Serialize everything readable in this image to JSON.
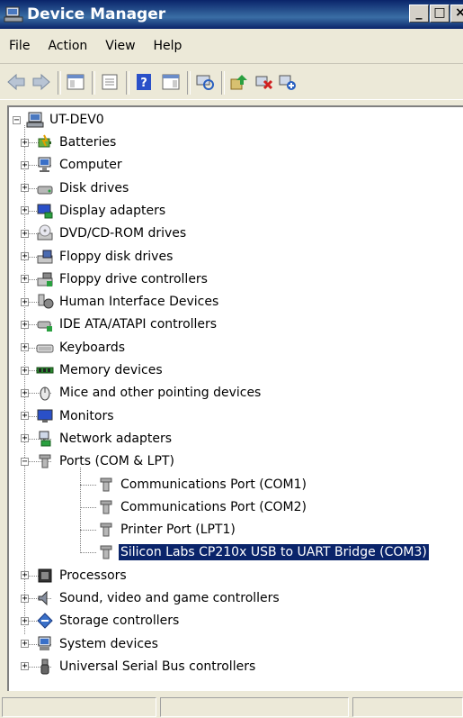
{
  "window": {
    "title": "Device Manager"
  },
  "menu": [
    "File",
    "Action",
    "View",
    "Help"
  ],
  "tree": {
    "root": "UT-DEV0",
    "categories": [
      {
        "label": "Batteries",
        "icon": "battery-icon"
      },
      {
        "label": "Computer",
        "icon": "computer-icon"
      },
      {
        "label": "Disk drives",
        "icon": "disk-drive-icon"
      },
      {
        "label": "Display adapters",
        "icon": "display-adapter-icon"
      },
      {
        "label": "DVD/CD-ROM drives",
        "icon": "dvd-drive-icon"
      },
      {
        "label": "Floppy disk drives",
        "icon": "floppy-drive-icon"
      },
      {
        "label": "Floppy drive controllers",
        "icon": "floppy-controller-icon"
      },
      {
        "label": "Human Interface Devices",
        "icon": "hid-icon"
      },
      {
        "label": "IDE ATA/ATAPI controllers",
        "icon": "ide-controller-icon"
      },
      {
        "label": "Keyboards",
        "icon": "keyboard-icon"
      },
      {
        "label": "Memory devices",
        "icon": "memory-icon"
      },
      {
        "label": "Mice and other pointing devices",
        "icon": "mouse-icon"
      },
      {
        "label": "Monitors",
        "icon": "monitor-icon"
      },
      {
        "label": "Network adapters",
        "icon": "network-adapter-icon"
      },
      {
        "label": "Ports (COM & LPT)",
        "icon": "port-icon"
      },
      {
        "label": "Processors",
        "icon": "processor-icon"
      },
      {
        "label": "Sound, video and game controllers",
        "icon": "sound-icon"
      },
      {
        "label": "Storage controllers",
        "icon": "storage-icon"
      },
      {
        "label": "System devices",
        "icon": "system-devices-icon"
      },
      {
        "label": "Universal Serial Bus controllers",
        "icon": "usb-icon"
      }
    ],
    "ports_children": [
      {
        "label": "Communications Port (COM1)"
      },
      {
        "label": "Communications Port (COM2)"
      },
      {
        "label": "Printer Port (LPT1)"
      },
      {
        "label": "Silicon Labs CP210x USB to UART Bridge (COM3)"
      }
    ]
  },
  "colors": {
    "selection": "#0a246a",
    "titlebar": "#0a246a",
    "chrome": "#ece9d8"
  }
}
